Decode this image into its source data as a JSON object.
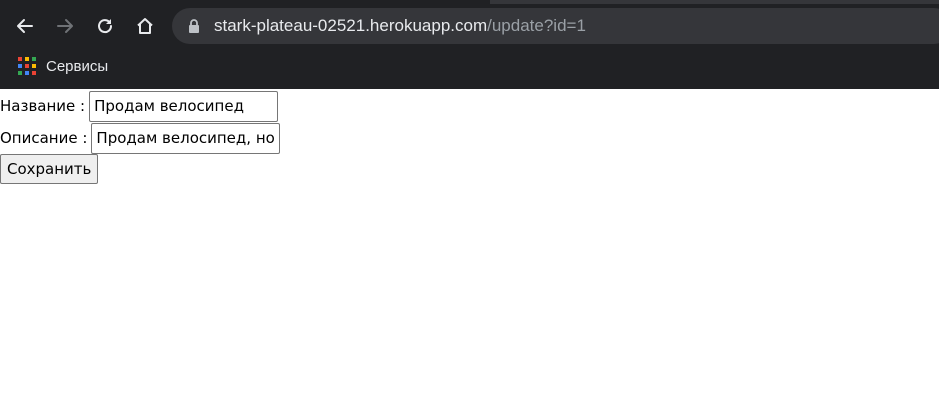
{
  "browser": {
    "url_host": "stark-plateau-02521.herokuapp.com",
    "url_path": "/update?id=1",
    "bookmarks": [
      {
        "label": "Сервисы",
        "icon": "apps-grid-icon"
      }
    ],
    "icons": {
      "back": "arrow-left-icon",
      "forward": "arrow-right-icon",
      "reload": "reload-icon",
      "home": "home-icon",
      "lock": "lock-icon"
    },
    "colors": {
      "chrome_bg": "#202124",
      "omnibox_bg": "#35363a",
      "text_primary": "#e8eaed",
      "text_muted": "#9aa0a6"
    }
  },
  "form": {
    "name_label": "Название :",
    "name_value": "Продам велосипед",
    "description_label": "Описание :",
    "description_value": "Продам велосипед, новый",
    "save_label": "Сохранить"
  }
}
